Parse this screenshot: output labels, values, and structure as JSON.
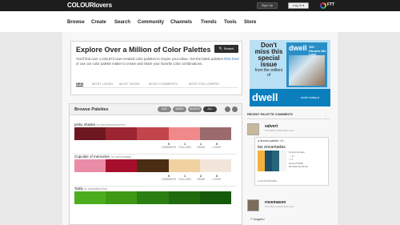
{
  "header": {
    "logo": "COLOURlovers",
    "signup": "Sign Up",
    "login": "Log In ▾",
    "ftt": "FTT"
  },
  "nav": [
    "Browse",
    "Create",
    "Search",
    "Community",
    "Channels",
    "Trends",
    "Tools",
    "Store"
  ],
  "hero": {
    "title": "Explore Over a Million of Color Palettes",
    "search_button": "🔍 Search",
    "desc_1": "You'll find over 1,228,873 user-created color palettes to inspire your ideas. Get the latest palettes ",
    "desc_link": "RSS feed",
    "desc_2": " or use our color palette maker to create and share your favorite color combinations.",
    "tabs": [
      "NEW",
      "MOST LOVED",
      "MOST VIEWS",
      "MOST COMMENTS",
      "MOST FOLLOWERS"
    ]
  },
  "ad": {
    "line1": "Don't miss this special issue",
    "line2": "from the editors of",
    "mag_title": "dwell",
    "mag_sub": "100 Houses We Love",
    "brand": "dwell",
    "order": "order today ▸"
  },
  "browse": {
    "title": "Browse Palettes",
    "filters": [
      "DAY",
      "WEEK",
      "MONTH",
      "ALL"
    ],
    "active_filter": "ALL"
  },
  "palettes": [
    {
      "name": "pinky shades",
      "by": "by rlamonieriarpalermo",
      "colors": [
        "#6d1820",
        "#9b2531",
        "#c2454c",
        "#f08a8a",
        "#9a6a6c"
      ],
      "stats": [
        {
          "n": "0",
          "l": "COMMENTS"
        },
        {
          "n": "1",
          "l": "FOLLOWS"
        },
        {
          "n": "1",
          "l": "VIEWS"
        },
        {
          "n": "0",
          "l": "LOVES"
        }
      ]
    },
    {
      "name": "Cupcake of memories.",
      "by": "by rarecrowalla",
      "colors": [
        "#ea8ca7",
        "#a60f2b",
        "#4a2d12",
        "#f0d1a0",
        "#f2e6da"
      ],
      "stats": [
        {
          "n": "0",
          "l": "COMMENTS"
        },
        {
          "n": "1",
          "l": "FOLLOWS"
        },
        {
          "n": "2",
          "l": "VIEWS"
        },
        {
          "n": "0",
          "l": "LOVES"
        }
      ]
    },
    {
      "name": "Tartly",
      "by": "by poetsaltlecimat",
      "colors": [
        "#4cae1e",
        "#3f9914",
        "#2b7f12",
        "#1f6b0e",
        "#155a0b"
      ],
      "stats": []
    }
  ],
  "recent": {
    "title": "RECENT PALETTE COMMENTS",
    "comments": [
      {
        "user": "valvert",
        "time": "POSTED 8 MINUTES AGO",
        "text": "a dream palette <3 ;",
        "palette": "las encantadas",
        "palette_by": "by kiwimiruque",
        "info": [
          "♡ 27",
          "☐ 3",
          "Rank #76168",
          "00-0000 00:00:00"
        ],
        "colors": [
          "#f4b23c",
          "#1b4f6b",
          "#26667d",
          "#f4f4f4"
        ],
        "foot": "▸ las encantadas"
      },
      {
        "user": "rovemaven",
        "time": "POSTED 9 MINUTES AGO",
        "text": "** Angelo!"
      }
    ]
  }
}
